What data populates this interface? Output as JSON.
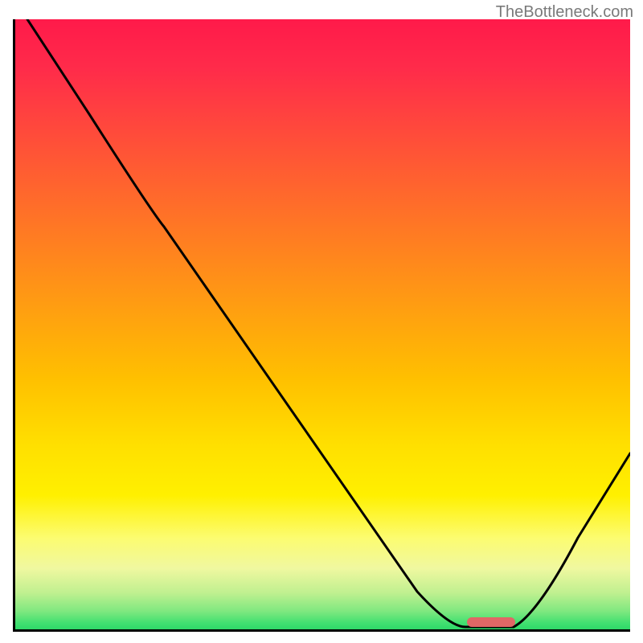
{
  "watermark": "TheBottleneck.com",
  "chart_data": {
    "type": "line",
    "title": "",
    "xlabel": "",
    "ylabel": "",
    "xlim": [
      0,
      100
    ],
    "ylim": [
      0,
      100
    ],
    "series": [
      {
        "name": "bottleneck-curve",
        "color": "#000000",
        "x": [
          2,
          10,
          20,
          24,
          30,
          40,
          50,
          60,
          68,
          72,
          78,
          82,
          88,
          95,
          100
        ],
        "y": [
          100,
          88,
          74,
          69,
          60,
          46,
          32,
          18,
          6,
          2,
          0,
          0,
          6,
          17,
          25
        ]
      }
    ],
    "marker": {
      "name": "optimal-zone-pill",
      "color": "#e06766",
      "x_center": 78,
      "y": 0,
      "width_pct": 8
    },
    "background_gradient": {
      "top": "#ff1a4a",
      "mid": "#ffc000",
      "bottom": "#2ed968"
    }
  }
}
